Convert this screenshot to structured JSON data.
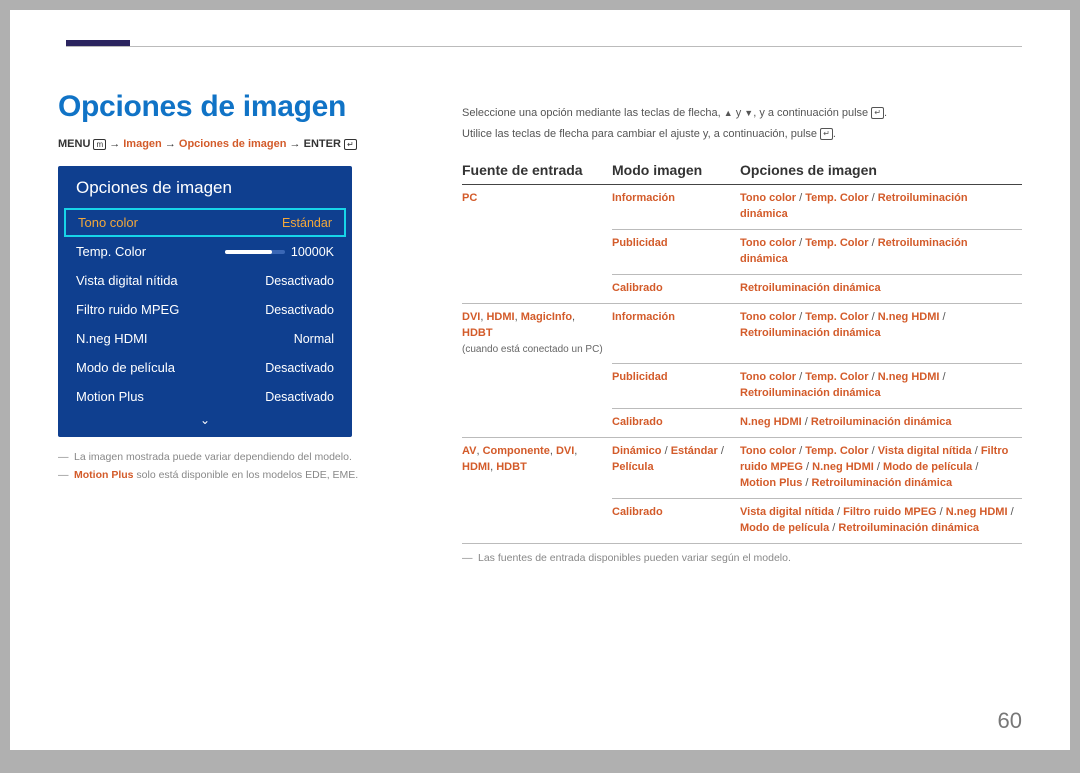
{
  "page": {
    "title": "Opciones de imagen",
    "number": "60"
  },
  "breadcrumb": {
    "menu": "MENU",
    "arrow": "→",
    "imagen": "Imagen",
    "opciones": "Opciones de imagen",
    "enter": "ENTER"
  },
  "osd": {
    "title": "Opciones de imagen",
    "rows": [
      {
        "label": "Tono color",
        "value": "Estándar",
        "selected": true
      },
      {
        "label": "Temp. Color",
        "value": "10000K",
        "slider": true
      },
      {
        "label": "Vista digital nítida",
        "value": "Desactivado"
      },
      {
        "label": "Filtro ruido MPEG",
        "value": "Desactivado"
      },
      {
        "label": "N.neg HDMI",
        "value": "Normal"
      },
      {
        "label": "Modo de película",
        "value": "Desactivado"
      },
      {
        "label": "Motion Plus",
        "value": "Desactivado"
      }
    ]
  },
  "footnotes": {
    "f1": "La imagen mostrada puede variar dependiendo del modelo.",
    "f2_strong": "Motion Plus",
    "f2_rest": " solo está disponible en los modelos EDE, EME."
  },
  "instructions": {
    "line1_a": "Seleccione una opción mediante las teclas de flecha, ",
    "line1_b": " y ",
    "line1_c": ", y a continuación pulse ",
    "line1_d": ".",
    "line2_a": "Utilice las teclas de flecha para cambiar el ajuste y, a continuación, pulse ",
    "line2_b": "."
  },
  "table": {
    "headers": {
      "a": "Fuente de entrada",
      "b": "Modo imagen",
      "c": "Opciones de imagen"
    },
    "rows": [
      {
        "src_parts": [
          "PC"
        ],
        "src_note": "",
        "mode_parts": [
          "Información"
        ],
        "opts": "Tono color / Temp. Color / Retroiluminación dinámica"
      },
      {
        "src_parts": [],
        "mode_parts": [
          "Publicidad"
        ],
        "opts": "Tono color / Temp. Color / Retroiluminación dinámica"
      },
      {
        "src_parts": [],
        "mode_parts": [
          "Calibrado"
        ],
        "opts": "Retroiluminación dinámica"
      },
      {
        "src_parts": [
          "DVI",
          "HDMI",
          "MagicInfo",
          "HDBT"
        ],
        "src_note": "(cuando está conectado un PC)",
        "mode_parts": [
          "Información"
        ],
        "opts": "Tono color / Temp. Color / N.neg HDMI / Retroiluminación dinámica"
      },
      {
        "src_parts": [],
        "mode_parts": [
          "Publicidad"
        ],
        "opts": "Tono color / Temp. Color / N.neg HDMI / Retroiluminación dinámica"
      },
      {
        "src_parts": [],
        "mode_parts": [
          "Calibrado"
        ],
        "opts": "N.neg HDMI / Retroiluminación dinámica"
      },
      {
        "src_parts": [
          "AV",
          "Componente",
          "DVI",
          "HDMI",
          "HDBT"
        ],
        "src_note": "",
        "mode_parts": [
          "Dinámico",
          "Estándar",
          "Película"
        ],
        "opts": "Tono color / Temp. Color / Vista digital nítida / Filtro ruido MPEG / N.neg HDMI / Modo de película / Motion Plus / Retroiluminación dinámica"
      },
      {
        "src_parts": [],
        "mode_parts": [
          "Calibrado"
        ],
        "opts": "Vista digital nítida / Filtro ruido MPEG / N.neg HDMI / Modo de película / Retroiluminación dinámica"
      }
    ],
    "footnote": "Las fuentes de entrada disponibles pueden variar según el modelo."
  }
}
